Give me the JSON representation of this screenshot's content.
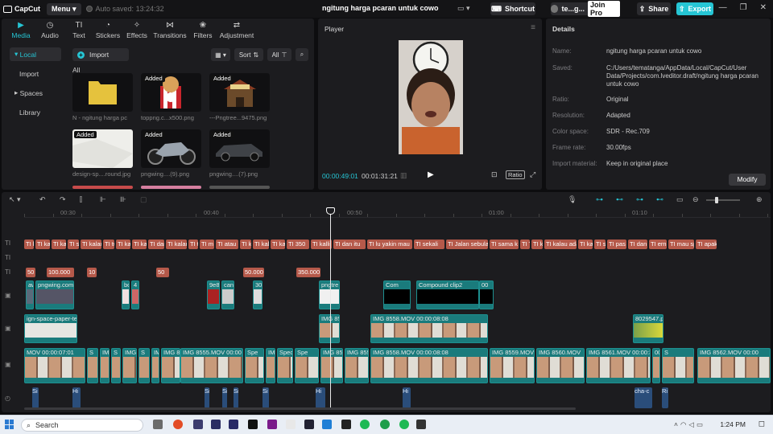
{
  "app": {
    "name": "CapCut",
    "menu_label": "Menu",
    "autosave": "Auto saved: 13:24:32",
    "project_title": "ngitung harga pcaran untuk cowo"
  },
  "titlebar": {
    "shortcut_label": "Shortcut",
    "user_label": "te...g...",
    "join_pro_label": "Join Pro",
    "share_label": "Share",
    "export_label": "Export"
  },
  "toolbar": {
    "tools": [
      {
        "label": "Media",
        "icon": "▶"
      },
      {
        "label": "Audio",
        "icon": "◷"
      },
      {
        "label": "Text",
        "icon": "TI"
      },
      {
        "label": "Stickers",
        "icon": "◔"
      },
      {
        "label": "Effects",
        "icon": "✧"
      },
      {
        "label": "Transitions",
        "icon": "⋈"
      },
      {
        "label": "Filters",
        "icon": "❀"
      },
      {
        "label": "Adjustment",
        "icon": "⇄"
      }
    ]
  },
  "media_nav": {
    "items": [
      "Local",
      "Import",
      "Spaces",
      "Library"
    ]
  },
  "media": {
    "import_label": "Import",
    "sort_label": "Sort",
    "filter_label": "All",
    "all_heading": "All",
    "items": [
      {
        "caption": "N - ngitung harga pc",
        "added": "",
        "kind": "folder"
      },
      {
        "caption": "toppng.c...x500.png",
        "added": "Added",
        "kind": "kfc"
      },
      {
        "caption": "---Pngtree...9475.png",
        "added": "Added",
        "kind": "shop"
      },
      {
        "caption": "design-sp....round.jpg",
        "added": "Added",
        "kind": "paper"
      },
      {
        "caption": "pngwing....(9).png",
        "added": "Added",
        "kind": "moto"
      },
      {
        "caption": "pngwing....(7).png",
        "added": "Added",
        "kind": "car"
      }
    ]
  },
  "player": {
    "title": "Player",
    "current_time": "00:00:49:01",
    "total_time": "00:01:31:21",
    "ratio_label": "Ratio"
  },
  "details": {
    "title": "Details",
    "rows": [
      {
        "key": "Name:",
        "value": "ngitung harga pcaran untuk cowo"
      },
      {
        "key": "Saved:",
        "value": "C:/Users/tematanga/AppData/Local/CapCut/User Data/Projects/com.lveditor.draft/ngitung harga pcaran untuk cowo"
      },
      {
        "key": "Ratio:",
        "value": "Original"
      },
      {
        "key": "Resolution:",
        "value": "Adapted"
      },
      {
        "key": "Color space:",
        "value": "SDR - Rec.709"
      },
      {
        "key": "Frame rate:",
        "value": "30.00fps"
      },
      {
        "key": "Import material:",
        "value": "Keep in original place"
      }
    ],
    "modify_label": "Modify"
  },
  "ruler": {
    "marks": [
      "00:30",
      "00:40",
      "00:50",
      "01:00",
      "01:10"
    ]
  },
  "tracks": {
    "labels": [
      "TI",
      "TI",
      "TI",
      "▣",
      "▣",
      "▣",
      "◴"
    ],
    "text1": [
      "kala",
      "kala",
      "kal",
      "sa",
      "kalau",
      "tu",
      "ka",
      "kal",
      "dan",
      "kalau",
      "tu",
      "m",
      "atau",
      "ka",
      "kal",
      "kal",
      "350",
      "kalli",
      "dan itu",
      "lu yakin mau",
      "sekali",
      "Jalan sebula",
      "sama k",
      "T",
      "kal",
      "kalau ada",
      "kal",
      "sa",
      "pas",
      "dan",
      "ern",
      "mau sp",
      "apak"
    ],
    "text3": [
      "50",
      "100.000",
      "10",
      "50",
      "50.000",
      "350.000"
    ],
    "overlay1": [
      "awit",
      "pngwing.com",
      "bo",
      "4",
      "9e8f",
      "can",
      "30",
      "pngtre",
      "Com",
      "Compound clip2",
      "00"
    ],
    "overlay2": [
      "ign-space-paper-te",
      "IMG 855",
      "IMG 8558.MOV",
      "00:00:08:08",
      "8029547.p"
    ],
    "main": [
      "MOV",
      "00:00:07:01",
      "S",
      "IMG",
      "S",
      "IMG",
      "S",
      "IMG 8555.MOV",
      "00:00",
      "Spe",
      "IMG",
      "Spec",
      "IMG 8557",
      "IMG 8558.MOV",
      "00:00:08:08",
      "IMG 8559.MOV",
      "00:00",
      "IMG 8560.MOV",
      "IMG 8561.MOV",
      "00:00:36:17",
      "IMG 8562.MOV",
      "00:00"
    ],
    "audio": [
      "Si",
      "Hi",
      "Si",
      "Si",
      "Si",
      "Si",
      "Hi",
      "Hi",
      "cha-c",
      "Ri"
    ]
  },
  "taskbar": {
    "search_placeholder": "Search",
    "time": "1:24 PM"
  }
}
